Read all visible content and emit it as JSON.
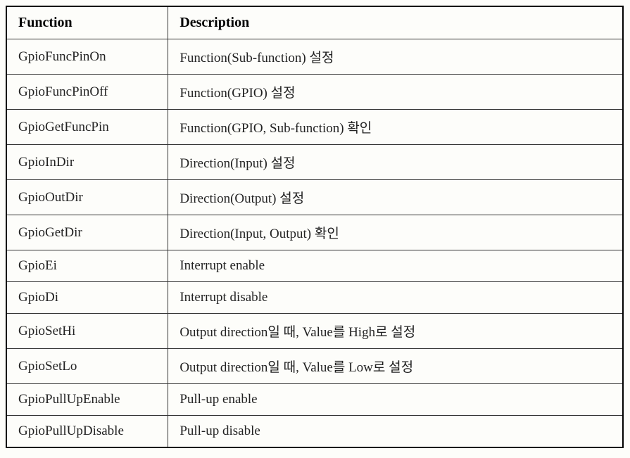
{
  "header": {
    "function": "Function",
    "description": "Description"
  },
  "rows": [
    {
      "function": "GpioFuncPinOn",
      "description": "Function(Sub-function) 설정"
    },
    {
      "function": "GpioFuncPinOff",
      "description": "Function(GPIO) 설정"
    },
    {
      "function": "GpioGetFuncPin",
      "description": "Function(GPIO, Sub-function) 확인"
    },
    {
      "function": "GpioInDir",
      "description": "Direction(Input) 설정"
    },
    {
      "function": "GpioOutDir",
      "description": "Direction(Output) 설정"
    },
    {
      "function": "GpioGetDir",
      "description": "Direction(Input, Output) 확인"
    },
    {
      "function": "GpioEi",
      "description": "Interrupt enable"
    },
    {
      "function": "GpioDi",
      "description": "Interrupt disable"
    },
    {
      "function": "GpioSetHi",
      "description": "Output direction일 때, Value를 High로 설정"
    },
    {
      "function": "GpioSetLo",
      "description": "Output direction일 때, Value를 Low로 설정"
    },
    {
      "function": "GpioPullUpEnable",
      "description": "Pull-up enable"
    },
    {
      "function": "GpioPullUpDisable",
      "description": "Pull-up disable"
    }
  ]
}
